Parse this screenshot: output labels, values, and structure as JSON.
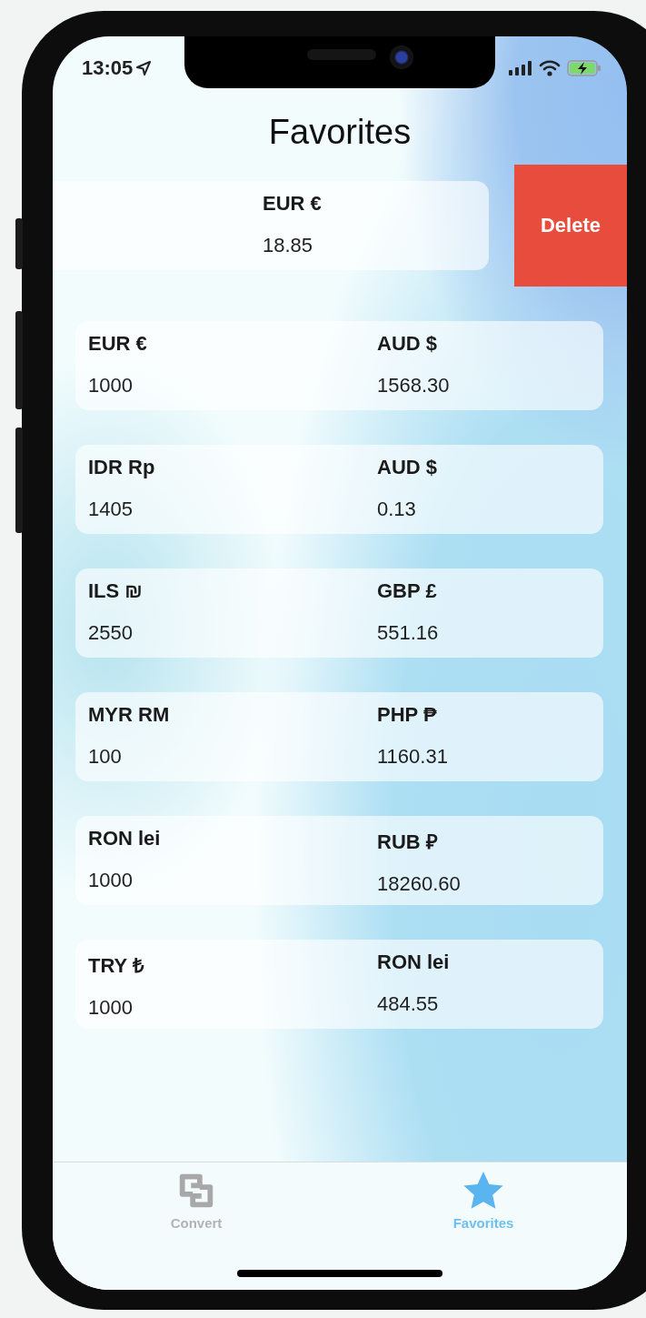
{
  "status_bar": {
    "time": "13:05"
  },
  "title": "Favorites",
  "swiped_row": {
    "currency": "EUR €",
    "amount": "18.85",
    "delete_label": "Delete"
  },
  "favorites": [
    {
      "from_currency": "EUR €",
      "from_amount": "1000",
      "to_currency": "AUD $",
      "to_amount": "1568.30"
    },
    {
      "from_currency": "IDR Rp",
      "from_amount": "1405",
      "to_currency": "AUD $",
      "to_amount": "0.13"
    },
    {
      "from_currency": "ILS ₪",
      "from_amount": "2550",
      "to_currency": "GBP £",
      "to_amount": "551.16"
    },
    {
      "from_currency": "MYR RM",
      "from_amount": "100",
      "to_currency": "PHP ₱",
      "to_amount": "1160.31"
    },
    {
      "from_currency": "RON lei",
      "from_amount": "1000",
      "to_currency": "RUB ₽",
      "to_amount": "18260.60"
    },
    {
      "from_currency": "TRY ₺",
      "from_amount": "1000",
      "to_currency": "RON lei",
      "to_amount": "484.55"
    }
  ],
  "tab_bar": [
    {
      "label": "Convert",
      "kind": "convert",
      "selected": false
    },
    {
      "label": "Favorites",
      "kind": "star",
      "selected": true
    }
  ]
}
